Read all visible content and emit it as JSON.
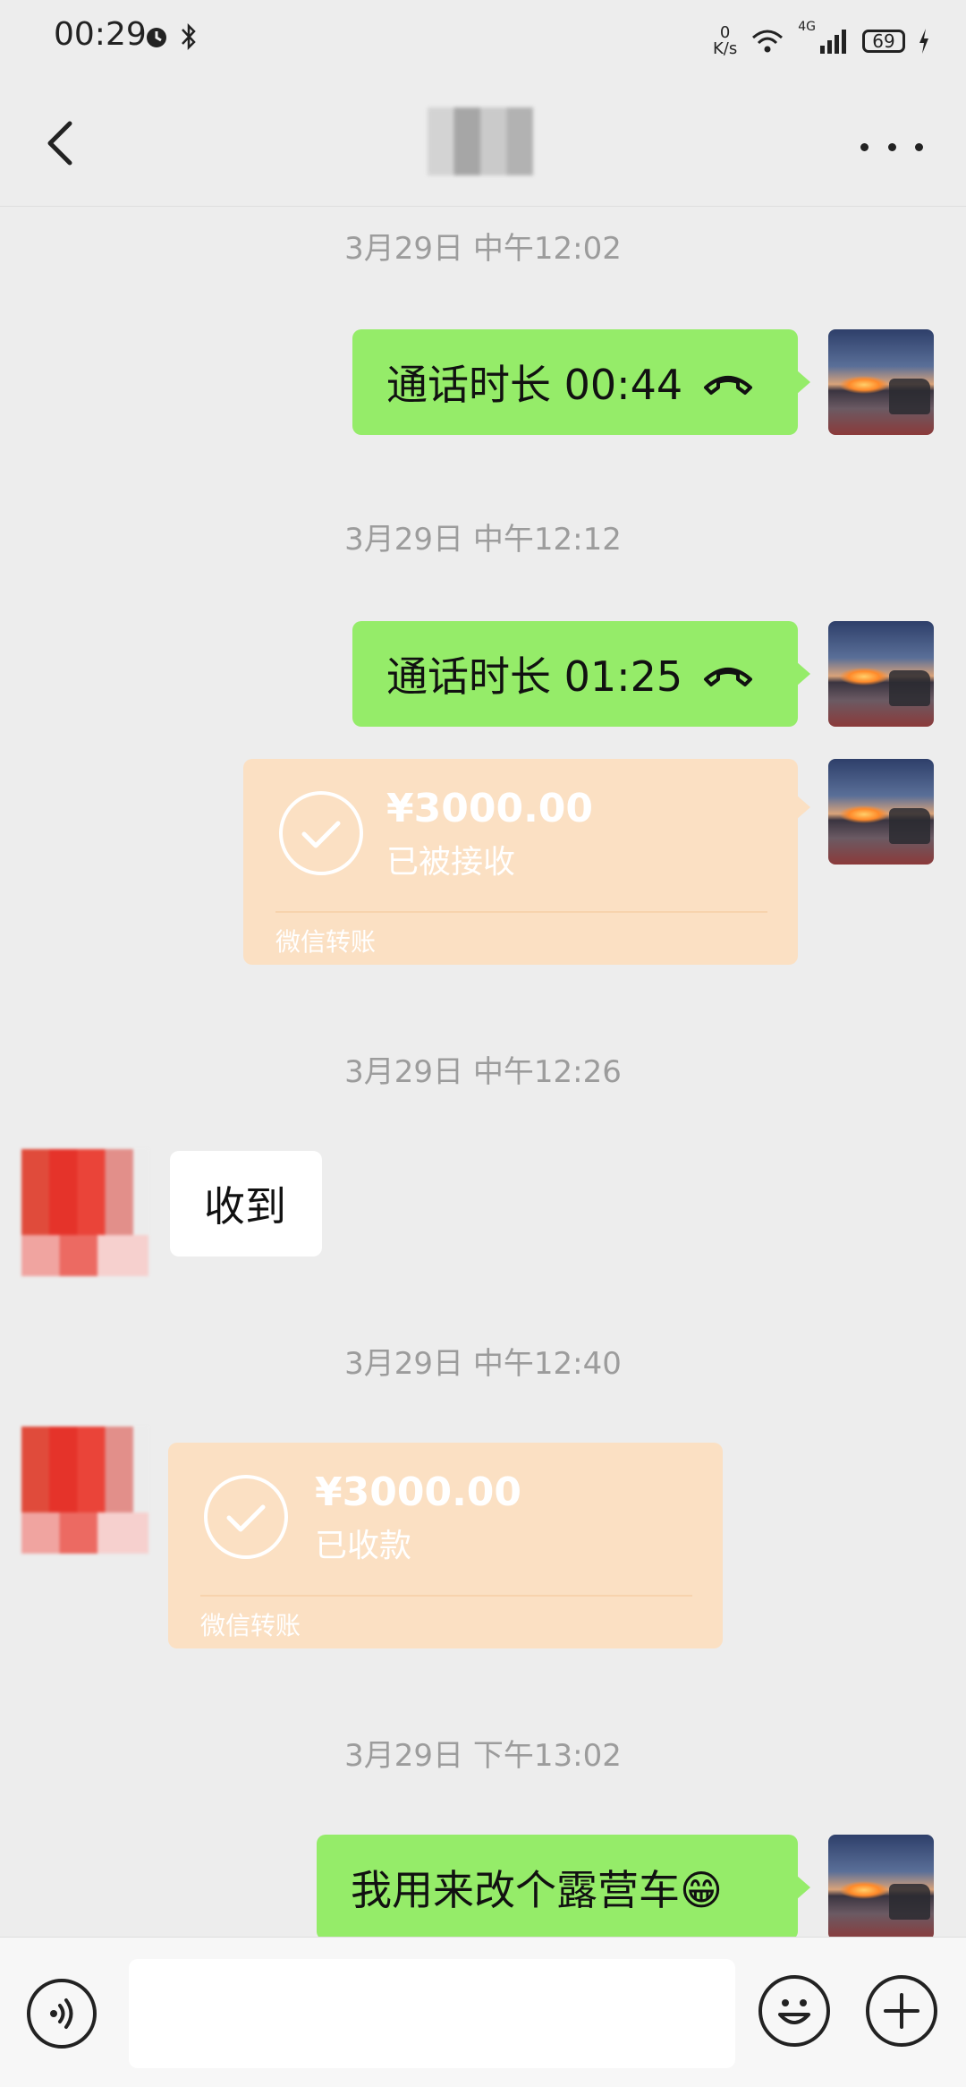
{
  "status_bar": {
    "time": "00:29",
    "net_speed_value": "0",
    "net_speed_unit": "K/s",
    "signal_label": "4G",
    "battery": "69"
  },
  "header": {
    "title": "",
    "back_icon": "chevron-left-icon",
    "more_icon": "more-horizontal-icon"
  },
  "messages": {
    "ts1": "3月29日 中午12:02",
    "call1": "通话时长 00:44",
    "ts2": "3月29日 中午12:12",
    "call2": "通话时长 01:25",
    "transfer_sent": {
      "amount": "¥3000.00",
      "status": "已被接收",
      "label": "微信转账"
    },
    "ts3": "3月29日 中午12:26",
    "reply": "收到",
    "ts4": "3月29日 中午12:40",
    "transfer_received": {
      "amount": "¥3000.00",
      "status": "已收款",
      "label": "微信转账"
    },
    "ts5": "3月29日 下午13:02",
    "last_text": "我用来改个露营车😁"
  },
  "input_bar": {
    "placeholder": "",
    "voice_icon": "voice-icon",
    "emoji_icon": "emoji-icon",
    "plus_icon": "plus-icon"
  },
  "colors": {
    "background": "#ededed",
    "green_bubble": "#95ec69",
    "transfer_bubble": "#fbe0c3",
    "timestamp": "#9c9c9c"
  }
}
